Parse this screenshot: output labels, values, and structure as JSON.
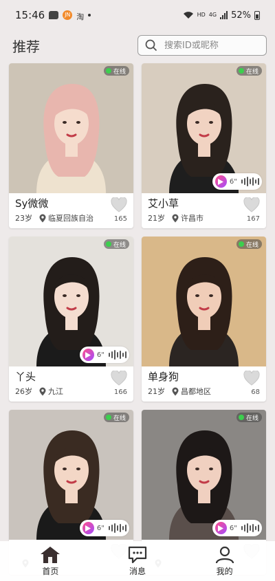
{
  "status_bar": {
    "time": "15:46",
    "notification_icons": [
      "message-icon",
      "app-icon",
      "taobao-icon"
    ],
    "app_icon_text": "JN",
    "taobao_text": "淘",
    "hd": "HD",
    "network": "4G",
    "battery": "52%"
  },
  "header": {
    "title": "推荐",
    "search_placeholder": "搜索ID或昵称"
  },
  "cards": [
    {
      "name": "Sy微微",
      "age": "23岁",
      "location": "临夏回族自治",
      "likes": "165",
      "online": "在线",
      "voice": false,
      "duration": "",
      "palette": {
        "bg": "#cdc4b6",
        "hair": "#e8b6ae",
        "skin": "#f5dccd",
        "cloth": "#eee2cf"
      }
    },
    {
      "name": "艾小草",
      "age": "21岁",
      "location": "许昌市",
      "likes": "167",
      "online": "在线",
      "voice": true,
      "duration": "6\"",
      "palette": {
        "bg": "#d8cdbf",
        "hair": "#2a221d",
        "skin": "#f1d3c2",
        "cloth": "#1e1e1e"
      }
    },
    {
      "name": "丫头",
      "age": "26岁",
      "location": "九江",
      "likes": "166",
      "online": "在线",
      "voice": true,
      "duration": "6\"",
      "palette": {
        "bg": "#e4e1dc",
        "hair": "#231d1a",
        "skin": "#f4ddd0",
        "cloth": "#1b1b1b"
      }
    },
    {
      "name": "单身狗",
      "age": "21岁",
      "location": "昌都地区",
      "likes": "68",
      "online": "在线",
      "voice": false,
      "duration": "",
      "palette": {
        "bg": "#d9b889",
        "hair": "#2d1f18",
        "skin": "#f0cdb8",
        "cloth": "#2b2522"
      }
    },
    {
      "name": "",
      "age": "",
      "location": "",
      "likes": "",
      "online": "在线",
      "voice": true,
      "duration": "6\"",
      "palette": {
        "bg": "#c9c3bd",
        "hair": "#3a2b22",
        "skin": "#f3d7c6",
        "cloth": "#1a1a1a"
      }
    },
    {
      "name": "",
      "age": "",
      "location": "",
      "likes": "",
      "online": "在线",
      "voice": true,
      "duration": "6\"",
      "palette": {
        "bg": "#8a8784",
        "hair": "#1d1817",
        "skin": "#f0d0c0",
        "cloth": "#5a4f4b"
      }
    }
  ],
  "tabs": [
    {
      "label": "首页",
      "icon": "home-icon"
    },
    {
      "label": "消息",
      "icon": "message-icon"
    },
    {
      "label": "我的",
      "icon": "profile-icon"
    }
  ]
}
